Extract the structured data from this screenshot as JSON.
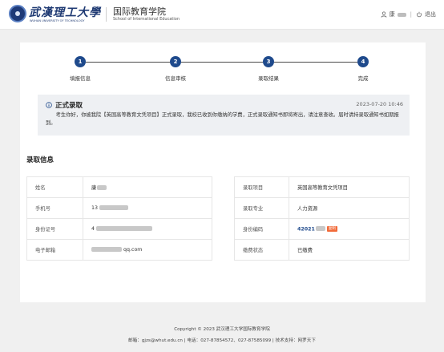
{
  "header": {
    "logo_cn": "武漢理工大學",
    "logo_en": "WUHAN UNIVERSITY OF TECHNOLOGY",
    "school_cn": "国际教育学院",
    "school_en": "School of International Education",
    "user_name": "康",
    "logout_label": "退出",
    "separator": "|"
  },
  "steps": [
    {
      "number": "1",
      "label": "填报信息"
    },
    {
      "number": "2",
      "label": "信息审核"
    },
    {
      "number": "3",
      "label": "录取结果"
    },
    {
      "number": "4",
      "label": "完成"
    }
  ],
  "notice": {
    "title": "正式录取",
    "date": "2023-07-20 10:46",
    "body": "考生你好，你被我院【英国高等教育文凭项目】正式录取，我校已收到你缴纳的学费，正式录取通知书即将寄出，请注意查收。届时请持录取通知书如期报到。"
  },
  "section_title": "录取信息",
  "left_rows": [
    {
      "key": "姓名",
      "value": "康"
    },
    {
      "key": "手机号",
      "value": "13"
    },
    {
      "key": "身份证号",
      "value": "4"
    },
    {
      "key": "电子邮箱",
      "value": "qq.com"
    }
  ],
  "right_rows": [
    {
      "key": "录取项目",
      "value": "英国高等教育文凭项目"
    },
    {
      "key": "录取专业",
      "value": "人力资源"
    },
    {
      "key": "身份编码",
      "value": "42021",
      "tag": "复制"
    },
    {
      "key": "缴费状态",
      "value": "已缴费"
    }
  ],
  "footer": {
    "copyright": "Copyright © 2023 武汉理工大学国际教育学院",
    "contact": "邮箱：gjzs@whut.edu.cn | 电话：027-87854572、027-87585099 | 技术支持：网罗天下"
  },
  "colors": {
    "primary": "#1f4a8c",
    "tag": "#f26b3a",
    "notice_bg": "#eef0f3",
    "page_bg": "#f0f0f0"
  }
}
